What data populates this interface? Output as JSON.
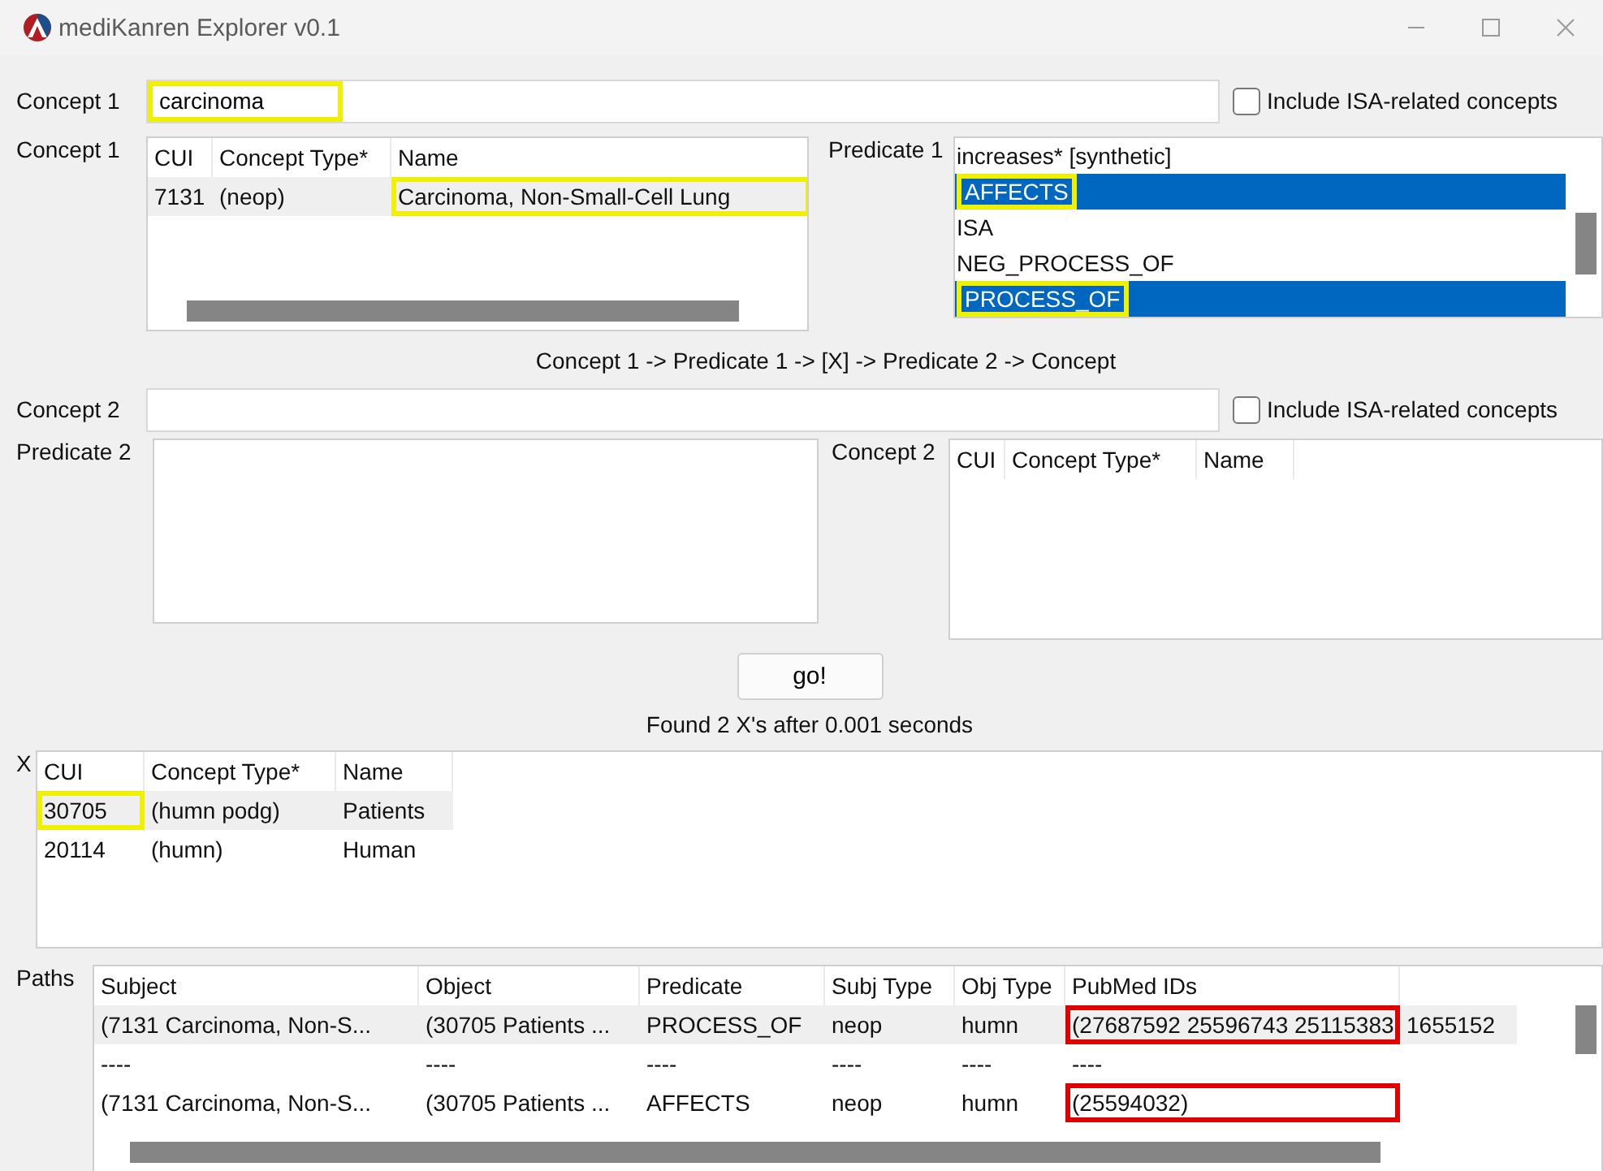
{
  "window": {
    "title": "mediKanren Explorer v0.1"
  },
  "concept1": {
    "label": "Concept 1",
    "value": "carcinoma",
    "color": "#f0f000",
    "isa": {
      "label": "Include ISA-related concepts",
      "checked": false
    }
  },
  "concept1_table": {
    "label": "Concept 1",
    "columns": [
      "CUI",
      "Concept Type*",
      "Name"
    ],
    "rows": [
      {
        "selected": true,
        "cells": [
          {
            "text": "7131"
          },
          {
            "text": "(neop)"
          },
          {
            "text": "Carcinoma, Non-Small-Cell Lung",
            "color": "#f0f000"
          }
        ]
      }
    ]
  },
  "predicate1": {
    "label": "Predicate 1",
    "items": [
      {
        "text": "increases* [synthetic]",
        "selected": false
      },
      {
        "text": "AFFECTS",
        "selected": true,
        "color": "#f0f000"
      },
      {
        "text": "ISA",
        "selected": false
      },
      {
        "text": "NEG_PROCESS_OF",
        "selected": false
      },
      {
        "text": "PROCESS_OF",
        "selected": true,
        "color": "#f0f000"
      }
    ]
  },
  "route": "Concept 1 -> Predicate 1 -> [X] -> Predicate 2 -> Concept",
  "concept2": {
    "label": "Concept 2",
    "isa": {
      "label": "Include ISA-related concepts",
      "checked": false
    }
  },
  "predicate2": {
    "label": "Predicate 2"
  },
  "concept2_table": {
    "label": "Concept 2",
    "columns": [
      "CUI",
      "Concept Type*",
      "Name"
    ]
  },
  "go_button": "go!",
  "status": "Found 2 X's after 0.001 seconds",
  "x_table": {
    "label": "X",
    "columns": [
      "CUI",
      "Concept Type*",
      "Name"
    ],
    "rows": [
      {
        "selected": true,
        "cells": [
          {
            "text": "30705",
            "color": "#f0f000"
          },
          {
            "text": "(humn podg)"
          },
          {
            "text": "Patients"
          }
        ]
      },
      {
        "selected": false,
        "cells": [
          {
            "text": "20114"
          },
          {
            "text": "(humn)"
          },
          {
            "text": "Human"
          }
        ]
      }
    ]
  },
  "paths_table": {
    "label": "Paths",
    "columns": [
      "Subject",
      "Object",
      "Predicate",
      "Subj Type",
      "Obj Type",
      "PubMed IDs"
    ],
    "rows": [
      {
        "selected": true,
        "cells": [
          {
            "text": "(7131 Carcinoma, Non-S..."
          },
          {
            "text": "(30705 Patients ..."
          },
          {
            "text": "PROCESS_OF"
          },
          {
            "text": "neop"
          },
          {
            "text": "humn"
          },
          {
            "text": "(27687592 25596743 25115383",
            "color": "#e00000"
          },
          {
            "text": "1655152"
          }
        ]
      },
      {
        "selected": false,
        "cells": [
          {
            "text": "----"
          },
          {
            "text": "----"
          },
          {
            "text": "----"
          },
          {
            "text": "----"
          },
          {
            "text": "----"
          },
          {
            "text": "----"
          }
        ]
      },
      {
        "selected": false,
        "cells": [
          {
            "text": "(7131 Carcinoma, Non-S..."
          },
          {
            "text": "(30705 Patients ..."
          },
          {
            "text": "AFFECTS"
          },
          {
            "text": "neop"
          },
          {
            "text": "humn"
          },
          {
            "text": "(25594032)",
            "color": "#e00000"
          }
        ]
      }
    ]
  }
}
